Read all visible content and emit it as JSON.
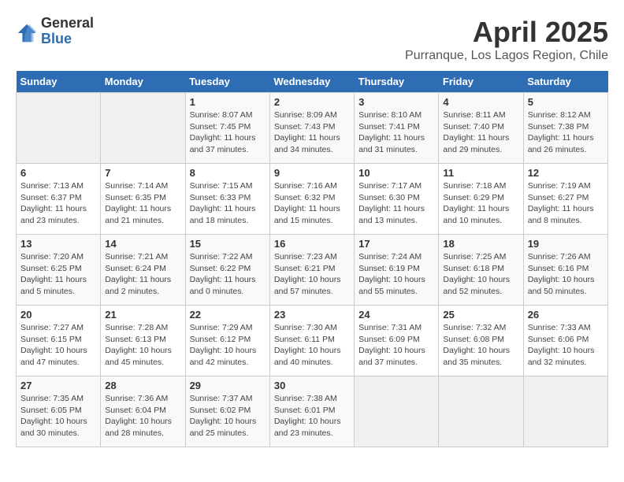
{
  "logo": {
    "general": "General",
    "blue": "Blue"
  },
  "title": "April 2025",
  "subtitle": "Purranque, Los Lagos Region, Chile",
  "headers": [
    "Sunday",
    "Monday",
    "Tuesday",
    "Wednesday",
    "Thursday",
    "Friday",
    "Saturday"
  ],
  "weeks": [
    [
      {
        "num": "",
        "detail": ""
      },
      {
        "num": "",
        "detail": ""
      },
      {
        "num": "1",
        "detail": "Sunrise: 8:07 AM\nSunset: 7:45 PM\nDaylight: 11 hours and 37 minutes."
      },
      {
        "num": "2",
        "detail": "Sunrise: 8:09 AM\nSunset: 7:43 PM\nDaylight: 11 hours and 34 minutes."
      },
      {
        "num": "3",
        "detail": "Sunrise: 8:10 AM\nSunset: 7:41 PM\nDaylight: 11 hours and 31 minutes."
      },
      {
        "num": "4",
        "detail": "Sunrise: 8:11 AM\nSunset: 7:40 PM\nDaylight: 11 hours and 29 minutes."
      },
      {
        "num": "5",
        "detail": "Sunrise: 8:12 AM\nSunset: 7:38 PM\nDaylight: 11 hours and 26 minutes."
      }
    ],
    [
      {
        "num": "6",
        "detail": "Sunrise: 7:13 AM\nSunset: 6:37 PM\nDaylight: 11 hours and 23 minutes."
      },
      {
        "num": "7",
        "detail": "Sunrise: 7:14 AM\nSunset: 6:35 PM\nDaylight: 11 hours and 21 minutes."
      },
      {
        "num": "8",
        "detail": "Sunrise: 7:15 AM\nSunset: 6:33 PM\nDaylight: 11 hours and 18 minutes."
      },
      {
        "num": "9",
        "detail": "Sunrise: 7:16 AM\nSunset: 6:32 PM\nDaylight: 11 hours and 15 minutes."
      },
      {
        "num": "10",
        "detail": "Sunrise: 7:17 AM\nSunset: 6:30 PM\nDaylight: 11 hours and 13 minutes."
      },
      {
        "num": "11",
        "detail": "Sunrise: 7:18 AM\nSunset: 6:29 PM\nDaylight: 11 hours and 10 minutes."
      },
      {
        "num": "12",
        "detail": "Sunrise: 7:19 AM\nSunset: 6:27 PM\nDaylight: 11 hours and 8 minutes."
      }
    ],
    [
      {
        "num": "13",
        "detail": "Sunrise: 7:20 AM\nSunset: 6:25 PM\nDaylight: 11 hours and 5 minutes."
      },
      {
        "num": "14",
        "detail": "Sunrise: 7:21 AM\nSunset: 6:24 PM\nDaylight: 11 hours and 2 minutes."
      },
      {
        "num": "15",
        "detail": "Sunrise: 7:22 AM\nSunset: 6:22 PM\nDaylight: 11 hours and 0 minutes."
      },
      {
        "num": "16",
        "detail": "Sunrise: 7:23 AM\nSunset: 6:21 PM\nDaylight: 10 hours and 57 minutes."
      },
      {
        "num": "17",
        "detail": "Sunrise: 7:24 AM\nSunset: 6:19 PM\nDaylight: 10 hours and 55 minutes."
      },
      {
        "num": "18",
        "detail": "Sunrise: 7:25 AM\nSunset: 6:18 PM\nDaylight: 10 hours and 52 minutes."
      },
      {
        "num": "19",
        "detail": "Sunrise: 7:26 AM\nSunset: 6:16 PM\nDaylight: 10 hours and 50 minutes."
      }
    ],
    [
      {
        "num": "20",
        "detail": "Sunrise: 7:27 AM\nSunset: 6:15 PM\nDaylight: 10 hours and 47 minutes."
      },
      {
        "num": "21",
        "detail": "Sunrise: 7:28 AM\nSunset: 6:13 PM\nDaylight: 10 hours and 45 minutes."
      },
      {
        "num": "22",
        "detail": "Sunrise: 7:29 AM\nSunset: 6:12 PM\nDaylight: 10 hours and 42 minutes."
      },
      {
        "num": "23",
        "detail": "Sunrise: 7:30 AM\nSunset: 6:11 PM\nDaylight: 10 hours and 40 minutes."
      },
      {
        "num": "24",
        "detail": "Sunrise: 7:31 AM\nSunset: 6:09 PM\nDaylight: 10 hours and 37 minutes."
      },
      {
        "num": "25",
        "detail": "Sunrise: 7:32 AM\nSunset: 6:08 PM\nDaylight: 10 hours and 35 minutes."
      },
      {
        "num": "26",
        "detail": "Sunrise: 7:33 AM\nSunset: 6:06 PM\nDaylight: 10 hours and 32 minutes."
      }
    ],
    [
      {
        "num": "27",
        "detail": "Sunrise: 7:35 AM\nSunset: 6:05 PM\nDaylight: 10 hours and 30 minutes."
      },
      {
        "num": "28",
        "detail": "Sunrise: 7:36 AM\nSunset: 6:04 PM\nDaylight: 10 hours and 28 minutes."
      },
      {
        "num": "29",
        "detail": "Sunrise: 7:37 AM\nSunset: 6:02 PM\nDaylight: 10 hours and 25 minutes."
      },
      {
        "num": "30",
        "detail": "Sunrise: 7:38 AM\nSunset: 6:01 PM\nDaylight: 10 hours and 23 minutes."
      },
      {
        "num": "",
        "detail": ""
      },
      {
        "num": "",
        "detail": ""
      },
      {
        "num": "",
        "detail": ""
      }
    ]
  ]
}
